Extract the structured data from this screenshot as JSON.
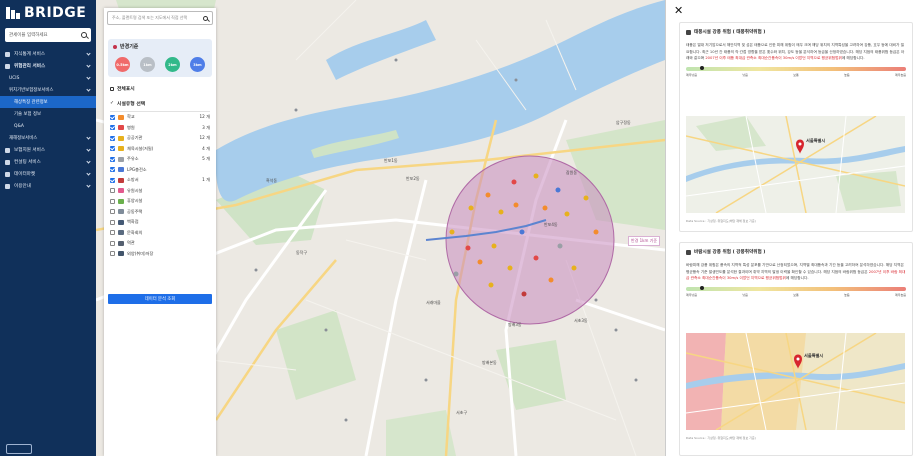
{
  "brand": {
    "name": "BRIDGE"
  },
  "sidebar": {
    "search_placeholder": "관세이율 입력하세요",
    "items": [
      {
        "label": "지식통계 서비스",
        "type": "top"
      },
      {
        "label": "위험관리 서비스",
        "type": "top-bold"
      },
      {
        "label": "UCIS",
        "type": "sub"
      },
      {
        "label": "위치기반보험정보서비스",
        "type": "sub"
      },
      {
        "label": "해상특징 관련정보",
        "type": "subsub-active"
      },
      {
        "label": "기술 보험 정보",
        "type": "subsub"
      },
      {
        "label": "Q&A",
        "type": "subsub"
      },
      {
        "label": "재해정보서비스",
        "type": "sub"
      },
      {
        "label": "보험지원 서비스",
        "type": "top"
      },
      {
        "label": "컨설팅 서비스",
        "type": "top"
      },
      {
        "label": "데이터마켓",
        "type": "top"
      },
      {
        "label": "이용안내",
        "type": "top"
      }
    ]
  },
  "map_search": {
    "placeholder": "주소, 플랜트명 검색 또는 지도에서 직접 선택"
  },
  "radius": {
    "title": "반경기준",
    "options": [
      {
        "label": "0.5km",
        "color": "#f06a6a"
      },
      {
        "label": "1km",
        "color": "#b9bfc6"
      },
      {
        "label": "2km",
        "color": "#32b98a"
      },
      {
        "label": "3km",
        "color": "#4f7ee8"
      }
    ]
  },
  "facility": {
    "title": "시설유형 선택",
    "items": [
      {
        "label": "학교",
        "count": "12 개",
        "checked": true,
        "color": "#f38c2d"
      },
      {
        "label": "병원",
        "count": "3 개",
        "checked": true,
        "color": "#e24848"
      },
      {
        "label": "공공기관",
        "count": "12 개",
        "checked": true,
        "color": "#e7b11d"
      },
      {
        "label": "체육시설(저밀)",
        "count": "4 개",
        "checked": true,
        "color": "#e7b11d"
      },
      {
        "label": "주유소",
        "count": "5 개",
        "checked": true,
        "color": "#9a9fa6"
      },
      {
        "label": "LPG충전소",
        "count": "",
        "checked": true,
        "color": "#4a78d6"
      },
      {
        "label": "소방서",
        "count": "1 개",
        "checked": true,
        "color": "#c23b3b"
      },
      {
        "label": "유원시설",
        "count": "",
        "checked": false,
        "color": "#e25a8e"
      },
      {
        "label": "휴양시설",
        "count": "",
        "checked": false,
        "color": "#6ab04c"
      },
      {
        "label": "공동주택",
        "count": "",
        "checked": false,
        "color": "#7f8c9a"
      },
      {
        "label": "백화점",
        "count": "",
        "checked": false,
        "color": "#455a75"
      },
      {
        "label": "문화회의",
        "count": "",
        "checked": false,
        "color": "#5a6b80"
      },
      {
        "label": "역관",
        "count": "",
        "checked": false,
        "color": "#556070"
      },
      {
        "label": "외양(취미)저장",
        "count": "",
        "checked": false,
        "color": "#42556b"
      }
    ],
    "show_facility_label": "전체표시",
    "analyze_button": "데이터 분석 조회"
  },
  "map_labels": {
    "radius_tag": "반경 1km 기준",
    "places": [
      "반포1동",
      "반포2동",
      "반포4동",
      "방배3동",
      "방배본동",
      "서초3동",
      "서래마을",
      "잠원동",
      "압구정동",
      "동작구",
      "서초구",
      "흑석동"
    ]
  },
  "report": {
    "close": "✕",
    "card1": {
      "title": "태풍시설 강풍 위험 ( 태풍취약위험 )",
      "text": "태풍은 열대 저기압으로서 해안지역 및 섬은 태풍으로 인한 피해 위험이 매우 크며 해당 위치의 지역특성을 고려하여 강풍, 호우 등에 대비가 필요합니다. 최근 10년 간 태풍의 직·간접 영향을 받은 횟수와 위치, 강도 등을 분석하여 등급을 산정하였습니다. 해당 지점의 태풍위험 등급은 아래와 같으며 ",
      "text_red": "2007년 이후 태풍 최대급 관측소 최대순간풍속이 30m/s 이었던 지역으로 평균위험범위",
      "text_end": "에 해당합니다.",
      "levels": [
        "매우낮음",
        "낮음",
        "보통",
        "높음",
        "매우높음"
      ],
      "caption": "Data Source : 기상청, 위험지도(해당 재해 정보 기준)"
    },
    "card2": {
      "title": "바람시설 강풍 위험 ( 강풍취약위험 )",
      "text": "바람피해 강풍 위험은 풍속의 지역적 특성 분포를 기반으로 산정되었으며, 지역별 최대풍속과 기간 등을 고려하여 분석하였습니다. 해당 지역은 평균풍속 기준 발생빈도를 분석한 결과이며 취약 지역의 발생 이력을 확인할 수 있습니다. 해당 지점의 바람위험 등급은 ",
      "text_red": "2007년 이후 바람 최대급 관측소 최대순간풍속이 30m/s 이었던 지역으로 평균위험범위",
      "text_end": "에 해당합니다.",
      "levels": [
        "매우낮음",
        "낮음",
        "보통",
        "높음",
        "매우높음"
      ],
      "caption": "Data Source : 기상청, 위험지도(해당 재해 정보 기준)"
    },
    "minimap_label": "서울특별시"
  }
}
